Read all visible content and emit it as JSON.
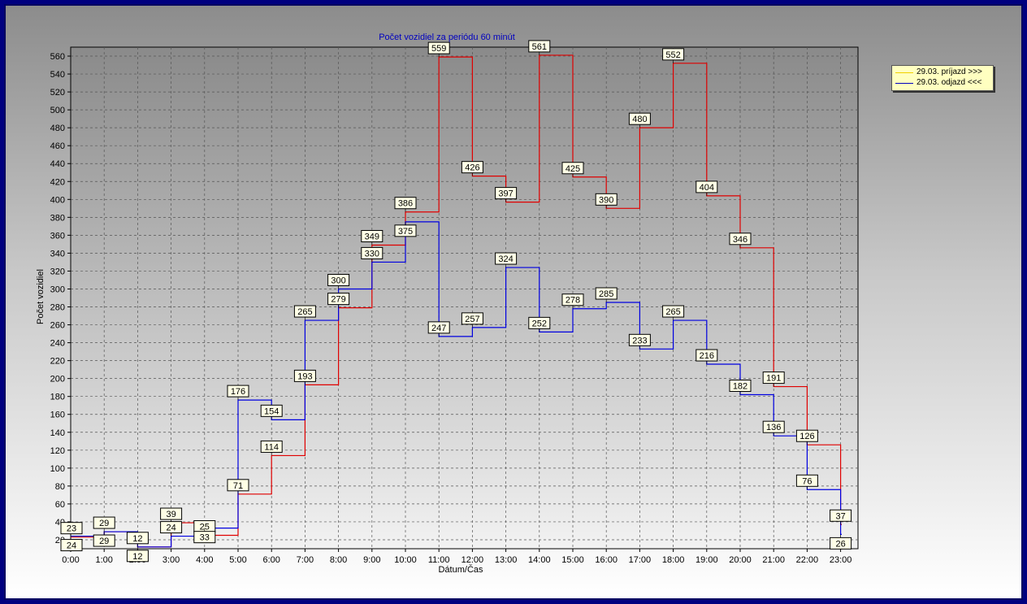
{
  "chart_data": {
    "type": "line",
    "step": true,
    "title": "Počet vozidiel za periódu 60 minút",
    "xlabel": "Dátum/Čas",
    "ylabel": "Počet vozidiel",
    "categories": [
      "0:00",
      "1:00",
      "2:00",
      "3:00",
      "4:00",
      "5:00",
      "6:00",
      "7:00",
      "8:00",
      "9:00",
      "10:00",
      "11:00",
      "12:00",
      "13:00",
      "14:00",
      "15:00",
      "16:00",
      "17:00",
      "18:00",
      "19:00",
      "20:00",
      "21:00",
      "22:00",
      "23:00"
    ],
    "ylim": [
      10,
      570
    ],
    "yticks": [
      20,
      40,
      60,
      80,
      100,
      120,
      140,
      160,
      180,
      200,
      220,
      240,
      260,
      280,
      300,
      320,
      340,
      360,
      380,
      400,
      420,
      440,
      460,
      480,
      500,
      520,
      540,
      560
    ],
    "grid": true,
    "legend_position": "top-right",
    "series": [
      {
        "name": "29.03.  príjazd >>>",
        "color": "#e00000",
        "values": [
          23,
          29,
          12,
          39,
          25,
          71,
          114,
          193,
          279,
          349,
          386,
          559,
          426,
          397,
          561,
          425,
          390,
          480,
          552,
          404,
          346,
          191,
          126,
          37
        ]
      },
      {
        "name": "29.03.  odjazd <<<",
        "color": "#0000e0",
        "values": [
          24,
          29,
          12,
          24,
          33,
          176,
          154,
          265,
          300,
          330,
          375,
          247,
          257,
          324,
          252,
          278,
          285,
          233,
          265,
          216,
          182,
          136,
          76,
          26
        ]
      }
    ]
  },
  "legend": {
    "items": [
      {
        "label": "29.03.  príjazd >>>",
        "color": "#f0d000"
      },
      {
        "label": "29.03.  odjazd <<<",
        "color": "#0000c0"
      }
    ]
  }
}
